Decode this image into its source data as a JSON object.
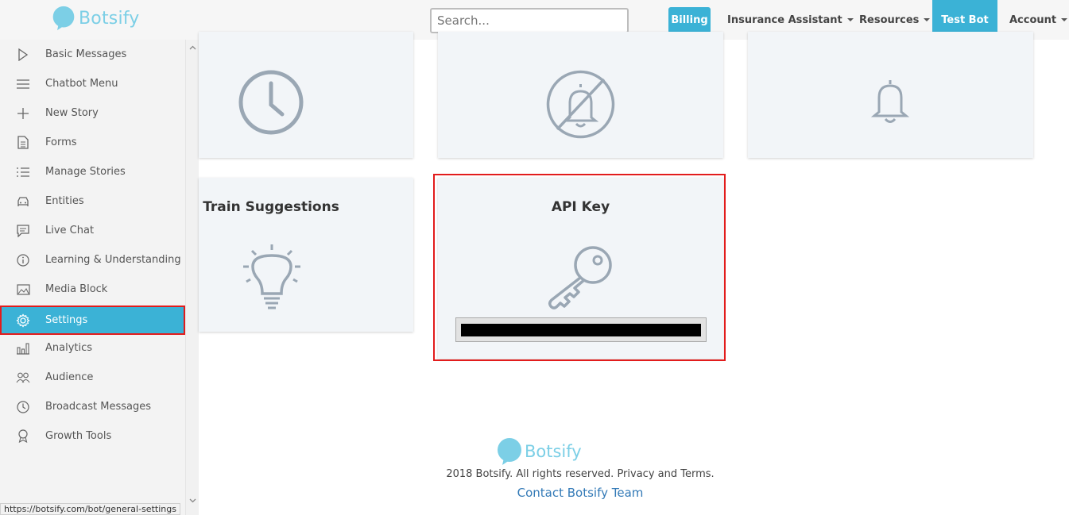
{
  "header": {
    "logo_text": "Botsify",
    "search_placeholder": "Search...",
    "billing": "Billing",
    "insurance_assistant": "Insurance Assistant",
    "resources": "Resources",
    "test_bot": "Test Bot",
    "account": "Account"
  },
  "sidebar": {
    "items": [
      {
        "label": "Basic Messages",
        "icon": "play-icon"
      },
      {
        "label": "Chatbot Menu",
        "icon": "menu-icon"
      },
      {
        "label": "New Story",
        "icon": "plus-icon"
      },
      {
        "label": "Forms",
        "icon": "document-icon"
      },
      {
        "label": "Manage Stories",
        "icon": "list-icon"
      },
      {
        "label": "Entities",
        "icon": "car-icon"
      },
      {
        "label": "Live Chat",
        "icon": "chat-icon"
      },
      {
        "label": "Learning & Understanding",
        "icon": "info-icon"
      },
      {
        "label": "Media Block",
        "icon": "image-icon"
      },
      {
        "label": "Settings",
        "icon": "gear-icon",
        "active": true
      },
      {
        "label": "Analytics",
        "icon": "bar-chart-icon"
      },
      {
        "label": "Audience",
        "icon": "users-icon"
      },
      {
        "label": "Broadcast Messages",
        "icon": "clock-icon"
      },
      {
        "label": "Growth Tools",
        "icon": "badge-icon"
      }
    ]
  },
  "status_url": "https://botsify.com/bot/general-settings",
  "cards": {
    "train_suggestions": "Train Suggestions",
    "api_key": "API Key"
  },
  "footer": {
    "logo_text": "Botsify",
    "copyright": "2018 Botsify. All rights reserved. Privacy and Terms.",
    "contact": "Contact Botsify Team"
  },
  "colors": {
    "accent": "#3bb2d6",
    "highlight": "#e21c1c",
    "icon_gray": "#9aa7b4"
  }
}
